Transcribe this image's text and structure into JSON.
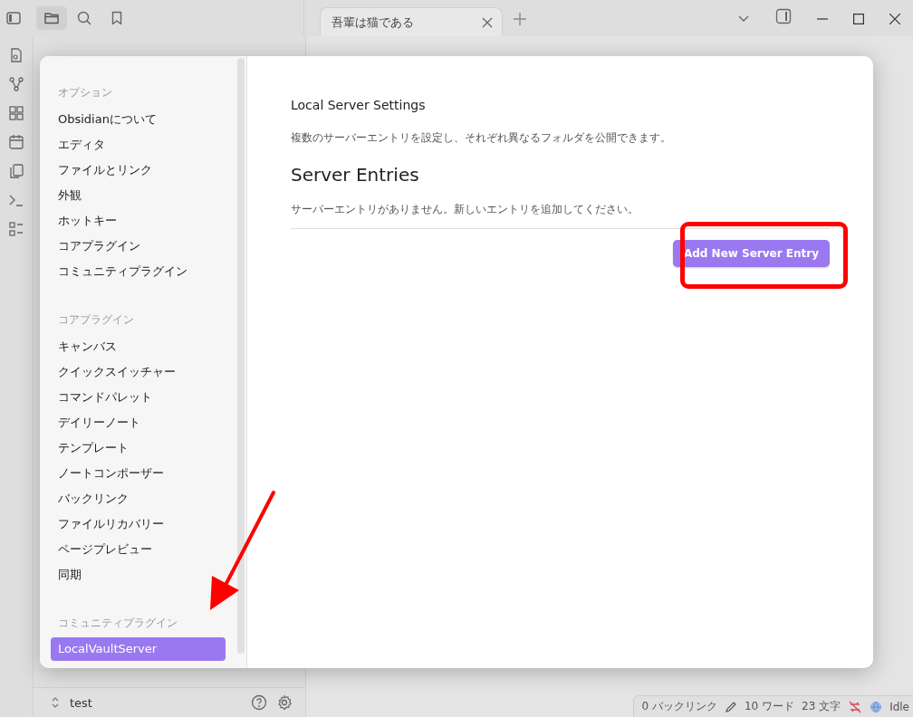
{
  "tab": {
    "title": "吾輩は猫である",
    "selected": true
  },
  "vault": {
    "name": "test"
  },
  "status_bar": {
    "backlinks": "0 バックリンク",
    "words": "10 ワード",
    "chars": "23 文字",
    "sync": "Idle"
  },
  "settings": {
    "sections": [
      {
        "heading": "オプション",
        "items": [
          {
            "label": "Obsidianについて",
            "selected": false
          },
          {
            "label": "エディタ",
            "selected": false
          },
          {
            "label": "ファイルとリンク",
            "selected": false
          },
          {
            "label": "外観",
            "selected": false
          },
          {
            "label": "ホットキー",
            "selected": false
          },
          {
            "label": "コアプラグイン",
            "selected": false
          },
          {
            "label": "コミュニティプラグイン",
            "selected": false
          }
        ]
      },
      {
        "heading": "コアプラグイン",
        "items": [
          {
            "label": "キャンバス",
            "selected": false
          },
          {
            "label": "クイックスイッチャー",
            "selected": false
          },
          {
            "label": "コマンドパレット",
            "selected": false
          },
          {
            "label": "デイリーノート",
            "selected": false
          },
          {
            "label": "テンプレート",
            "selected": false
          },
          {
            "label": "ノートコンポーザー",
            "selected": false
          },
          {
            "label": "バックリンク",
            "selected": false
          },
          {
            "label": "ファイルリカバリー",
            "selected": false
          },
          {
            "label": "ページプレビュー",
            "selected": false
          },
          {
            "label": "同期",
            "selected": false
          }
        ]
      },
      {
        "heading": "コミュニティプラグイン",
        "items": [
          {
            "label": "LocalVaultServer",
            "selected": true
          }
        ]
      }
    ],
    "content": {
      "title": "Local Server Settings",
      "description": "複数のサーバーエントリを設定し、それぞれ異なるフォルダを公開できます。",
      "heading": "Server Entries",
      "empty_message": "サーバーエントリがありません。新しいエントリを追加してください。",
      "button": "Add New Server Entry"
    }
  }
}
